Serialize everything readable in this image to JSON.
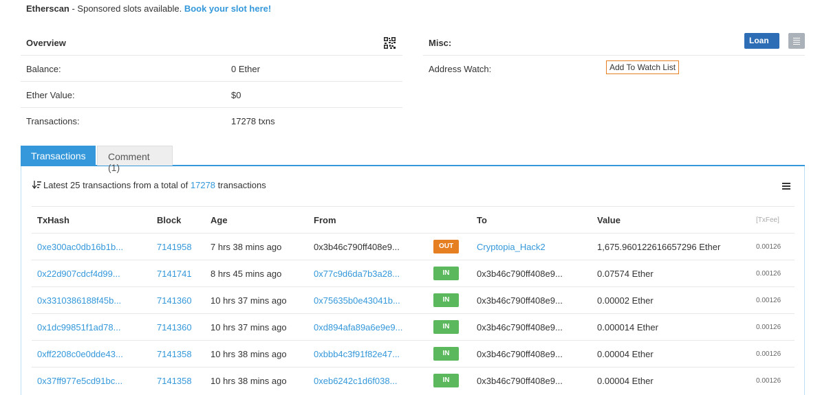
{
  "sponsor": {
    "brand": "Etherscan",
    "text": " - Sponsored slots available. ",
    "link": "Book your slot here!"
  },
  "overview": {
    "title": "Overview",
    "rows": [
      {
        "label": "Balance:",
        "value": "0 Ether"
      },
      {
        "label": "Ether Value:",
        "value": "$0"
      },
      {
        "label": "Transactions:",
        "value": "17278 txns"
      }
    ]
  },
  "misc": {
    "title": "Misc:",
    "loan_label": "Loan",
    "address_watch_label": "Address Watch:",
    "watch_button": "Add To Watch List"
  },
  "tabs": {
    "transactions": "Transactions",
    "comment": "Comment (1)"
  },
  "summary": {
    "prefix": "Latest 25 transactions from a total of ",
    "count": "17278",
    "suffix": " transactions"
  },
  "table": {
    "headers": {
      "txhash": "TxHash",
      "block": "Block",
      "age": "Age",
      "from": "From",
      "to": "To",
      "value": "Value",
      "fee": "[TxFee]"
    },
    "rows": [
      {
        "txhash": "0xe300ac0db16b1b...",
        "block": "7141958",
        "age": "7 hrs 38 mins ago",
        "from": "0x3b46c790ff408e9...",
        "from_link": false,
        "dir": "OUT",
        "to": "Cryptopia_Hack2",
        "to_link": true,
        "value": "1,675.960122616657296 Ether",
        "fee": "0.00126"
      },
      {
        "txhash": "0x22d907cdcf4d99...",
        "block": "7141741",
        "age": "8 hrs 45 mins ago",
        "from": "0x77c9d6da7b3a28...",
        "from_link": true,
        "dir": "IN",
        "to": "0x3b46c790ff408e9...",
        "to_link": false,
        "value": "0.07574 Ether",
        "fee": "0.00126"
      },
      {
        "txhash": "0x3310386188f45b...",
        "block": "7141360",
        "age": "10 hrs 37 mins ago",
        "from": "0x75635b0e43041b...",
        "from_link": true,
        "dir": "IN",
        "to": "0x3b46c790ff408e9...",
        "to_link": false,
        "value": "0.00002 Ether",
        "fee": "0.00126"
      },
      {
        "txhash": "0x1dc99851f1ad78...",
        "block": "7141360",
        "age": "10 hrs 37 mins ago",
        "from": "0xd894afa89a6e9e9...",
        "from_link": true,
        "dir": "IN",
        "to": "0x3b46c790ff408e9...",
        "to_link": false,
        "value": "0.000014 Ether",
        "fee": "0.00126"
      },
      {
        "txhash": "0xff2208c0e0dde43...",
        "block": "7141358",
        "age": "10 hrs 38 mins ago",
        "from": "0xbbb4c3f91f82e47...",
        "from_link": true,
        "dir": "IN",
        "to": "0x3b46c790ff408e9...",
        "to_link": false,
        "value": "0.00004 Ether",
        "fee": "0.00126"
      },
      {
        "txhash": "0x37ff977e5cd91bc...",
        "block": "7141358",
        "age": "10 hrs 38 mins ago",
        "from": "0xeb6242c1d6f038...",
        "from_link": true,
        "dir": "IN",
        "to": "0x3b46c790ff408e9...",
        "to_link": false,
        "value": "0.00004 Ether",
        "fee": "0.00126"
      }
    ]
  },
  "colors": {
    "link": "#3498db",
    "out_badge": "#e67e22",
    "in_badge": "#5cb85c",
    "loan_button": "#2d6db5"
  }
}
